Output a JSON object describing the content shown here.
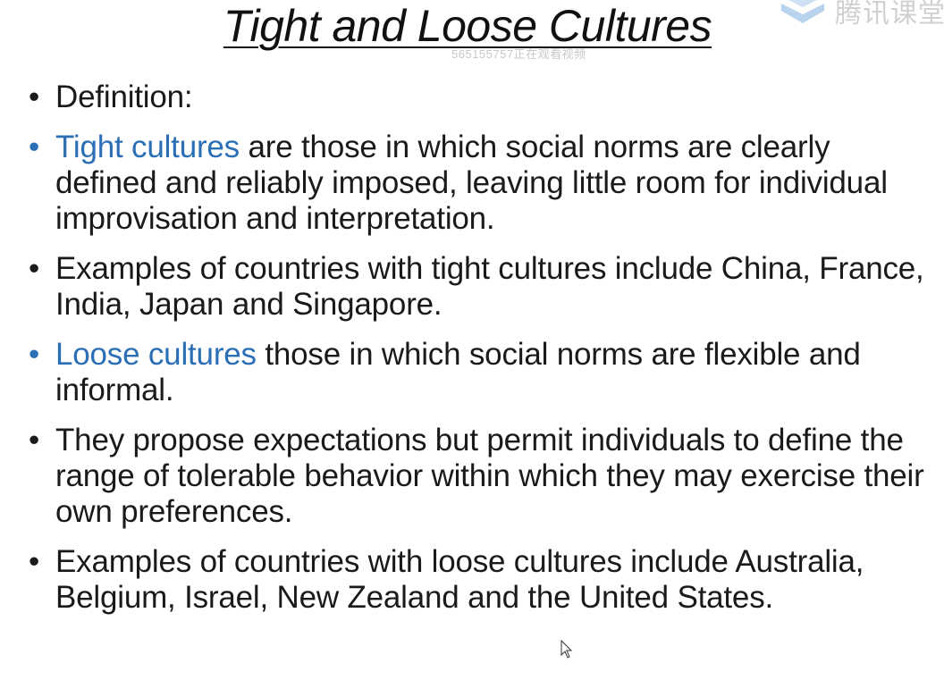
{
  "slide": {
    "title": "Tight and Loose Cultures",
    "watermark": "565155757正在观看视频",
    "logo_text": "腾讯课堂",
    "colors": {
      "text": "#1a1a1a",
      "highlight": "#2a6fb5",
      "background": "#ffffff"
    },
    "bullet_glyph": "•",
    "bullets": [
      {
        "highlight": "",
        "text": "Definition:"
      },
      {
        "highlight": "Tight cultures",
        "text": " are those in which social norms are clearly defined and reliably imposed, leaving little room for individual improvisation and interpretation."
      },
      {
        "highlight": "",
        "text": "Examples of countries with tight cultures include China, France, India, Japan and Singapore."
      },
      {
        "highlight": "Loose cultures",
        "text": " those in which social norms are flexible and informal."
      },
      {
        "highlight": "",
        "text": "They propose expectations but permit individuals to define the range of tolerable behavior within which they may exercise their own preferences."
      },
      {
        "highlight": "",
        "text": "Examples of countries with loose cultures include Australia, Belgium, Israel, New Zealand and the United States."
      }
    ]
  },
  "icons": {
    "logo": "tencent-classroom-logo-icon",
    "cursor": "mouse-pointer-icon"
  }
}
